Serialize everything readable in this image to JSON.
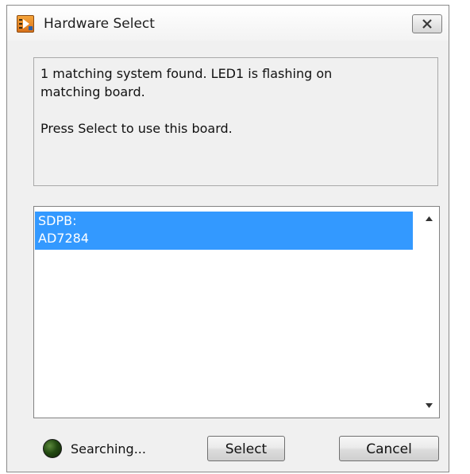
{
  "window": {
    "title": "Hardware Select"
  },
  "message": {
    "line1": "1 matching system found. LED1 is flashing on",
    "line2": "matching board.",
    "line3": "Press Select to use this board."
  },
  "list": {
    "items": [
      {
        "line1": "SDPB:",
        "line2": "AD7284",
        "selected": true
      }
    ]
  },
  "status": {
    "text": "Searching...",
    "led_color": "#234a12"
  },
  "buttons": {
    "select_label": "Select",
    "cancel_label": "Cancel"
  },
  "icons": {
    "app": "labview-app-icon",
    "close": "close-icon",
    "scroll_up": "scroll-up-arrow-icon",
    "scroll_down": "scroll-down-arrow-icon"
  },
  "colors": {
    "selection": "#3399ff",
    "window_bg": "#f0f0f0"
  }
}
